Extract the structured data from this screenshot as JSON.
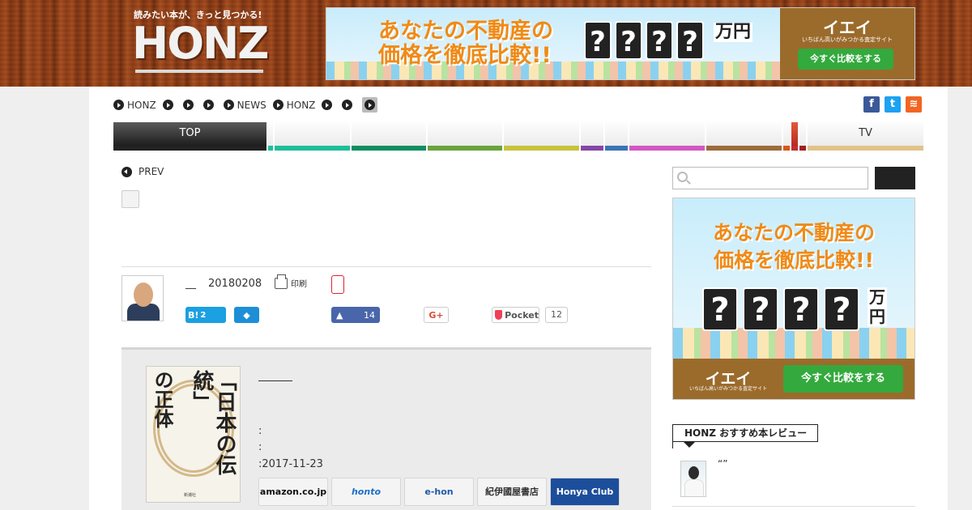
{
  "header": {
    "tagline": "読みたい本が、きっと見つかる!",
    "logo_text": "HONZ",
    "banner": {
      "headline_1": "あなたの不動産の",
      "headline_2": "価格を徹底比較!!",
      "question_marks": [
        "?",
        "?",
        "?",
        "?"
      ],
      "unit": "万円",
      "brand": "イエイ",
      "brand_sub": "いちばん高いがみつかる査定サイト",
      "cta": "今すぐ比較をする"
    }
  },
  "breadcrumb": {
    "items": [
      {
        "label": "HONZ"
      },
      {
        "label": ""
      },
      {
        "label": ""
      },
      {
        "label": ""
      },
      {
        "label": "NEWS"
      },
      {
        "label": "HONZ"
      },
      {
        "label": ""
      },
      {
        "label": ""
      },
      {
        "label": ""
      }
    ]
  },
  "social": {
    "icons": [
      "facebook-icon",
      "twitter-icon",
      "rss-icon"
    ],
    "colors": {
      "facebook": "#3b5998",
      "twitter": "#1da1f2",
      "rss": "#f26522"
    }
  },
  "nav": {
    "top_label": "TOP",
    "tv_label": "TV",
    "colors": [
      "#1ebe9b",
      "#0e8f62",
      "#6aa33c",
      "#c6c43c",
      "#8646a5",
      "#3a74b4",
      "#d257c2",
      "#9c6a3c",
      "#d45a1a",
      "#c03030",
      "#e2c28a"
    ]
  },
  "article": {
    "prev_label": "PREV",
    "author": "__",
    "date": "20180208",
    "print_label": "印刷",
    "hatena_label": "B!",
    "hatena_count": "2",
    "facebook_count": "14",
    "gplus_label": "G+",
    "pocket_label": "Pocket",
    "pocket_count": "12"
  },
  "book": {
    "cover_title_1": "「日本の伝統」",
    "cover_title_2": "の正体",
    "cover_publisher": "新潮社",
    "meta_1": ":",
    "meta_2": ":",
    "release": ":2017-11-23",
    "shops": [
      "amazon.co.jp",
      "honto",
      "e-hon",
      "紀伊國屋書店",
      "Honya Club"
    ]
  },
  "sidebar": {
    "search_placeholder": "",
    "banner": {
      "headline_1": "あなたの不動産の",
      "headline_2": "価格を徹底比較!!",
      "question_marks": [
        "?",
        "?",
        "?",
        "?"
      ],
      "unit": "万円",
      "brand": "イエイ",
      "brand_sub": "いちばん高いがみつかる査定サイト",
      "cta": "今すぐ比較をする"
    },
    "recommend_title": "HONZ おすすめ本レビュー",
    "recommend_quote": "“”"
  }
}
